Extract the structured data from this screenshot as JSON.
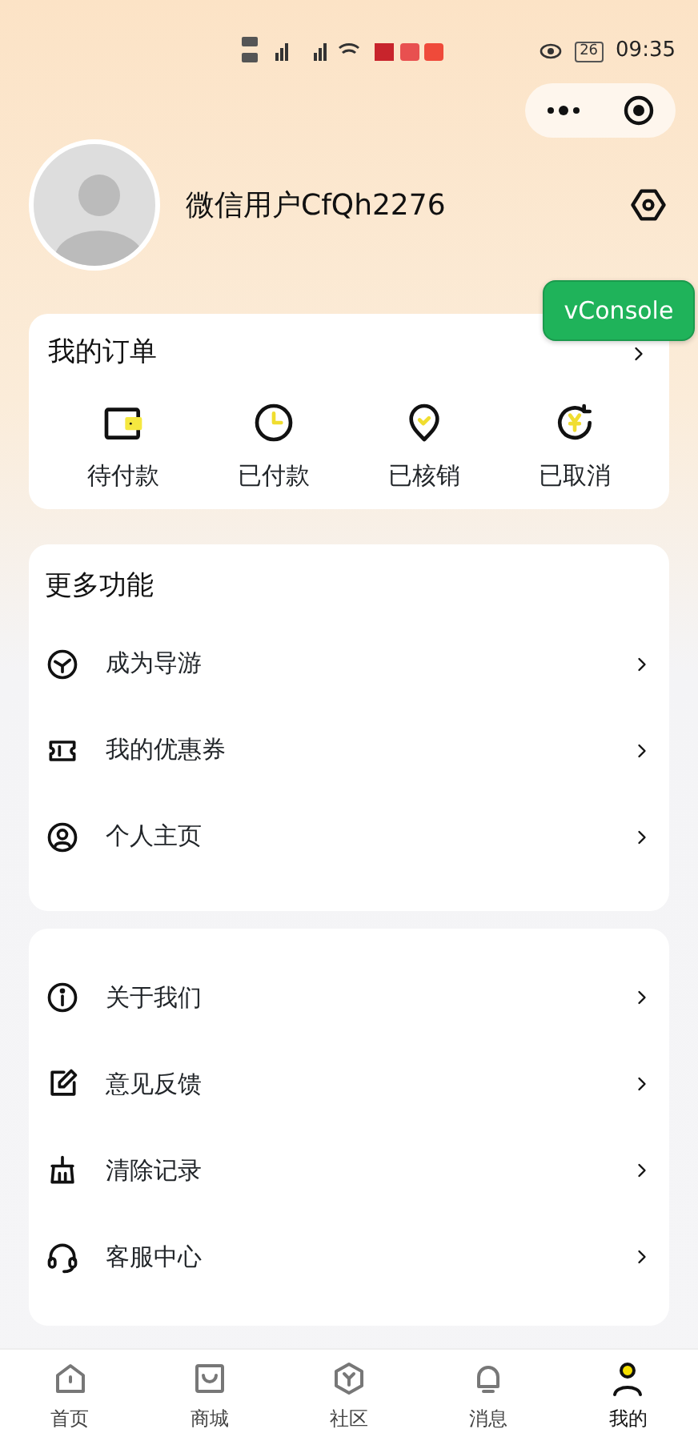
{
  "status_bar": {
    "battery": "26",
    "time": "09:35"
  },
  "profile": {
    "name": "微信用户CfQh2276"
  },
  "vconsole": {
    "label": "vConsole"
  },
  "orders": {
    "title": "我的订单",
    "items": [
      {
        "kind": "wallet",
        "label": "待付款"
      },
      {
        "kind": "clock",
        "label": "已付款"
      },
      {
        "kind": "pin",
        "label": "已核销"
      },
      {
        "kind": "refund",
        "label": "已取消"
      }
    ]
  },
  "more": {
    "title": "更多功能",
    "items": [
      {
        "kind": "guide",
        "label": "成为导游"
      },
      {
        "kind": "ticket",
        "label": "我的优惠券"
      },
      {
        "kind": "user",
        "label": "个人主页"
      }
    ]
  },
  "misc": {
    "items": [
      {
        "kind": "info",
        "label": "关于我们"
      },
      {
        "kind": "edit",
        "label": "意见反馈"
      },
      {
        "kind": "broom",
        "label": "清除记录"
      },
      {
        "kind": "headset",
        "label": "客服中心"
      }
    ]
  },
  "tabbar": [
    {
      "kind": "home",
      "label": "首页",
      "selected": false
    },
    {
      "kind": "bag",
      "label": "商城",
      "selected": false
    },
    {
      "kind": "hex",
      "label": "社区",
      "selected": false
    },
    {
      "kind": "bell",
      "label": "消息",
      "selected": false
    },
    {
      "kind": "person",
      "label": "我的",
      "selected": true
    }
  ]
}
